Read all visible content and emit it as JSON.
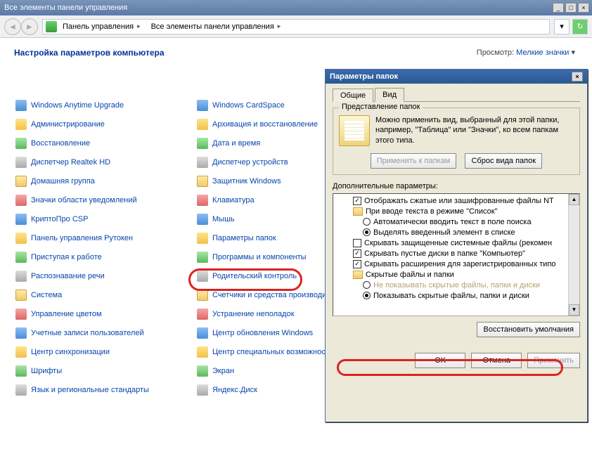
{
  "window": {
    "title": "Все элементы панели управления"
  },
  "breadcrumb": {
    "a": "Панель управления",
    "b": "Все элементы панели управления"
  },
  "page": {
    "heading": "Настройка параметров компьютера",
    "view_label": "Просмотр:",
    "view_value": "Мелкие значки"
  },
  "items_left": [
    "Windows Anytime Upgrade",
    "Администрирование",
    "Восстановление",
    "Диспетчер Realtek HD",
    "Домашняя группа",
    "Значки области уведомлений",
    "КриптоПро CSP",
    "Панель управления Рутокен",
    "Приступая к работе",
    "Распознавание речи",
    "Система",
    "Управление цветом",
    "Учетные записи пользователей",
    "Центр синхронизации",
    "Шрифты",
    "Язык и региональные стандарты"
  ],
  "items_right": [
    "Windows CardSpace",
    "Архивация и восстановление",
    "Дата и время",
    "Диспетчер устройств",
    "Защитник Windows",
    "Клавиатура",
    "Мышь",
    "Параметры папок",
    "Программы и компоненты",
    "Родительский контроль",
    "Счетчики и средства производите",
    "Устранение неполадок",
    "Центр обновления Windows",
    "Центр специальных возможностей",
    "Экран",
    "Яндекс.Диск"
  ],
  "dialog": {
    "title": "Параметры папок",
    "tabs": {
      "general": "Общие",
      "view": "Вид"
    },
    "folder_view": {
      "legend": "Представление папок",
      "text": "Можно применить вид, выбранный для этой папки, например, \"Таблица\" или \"Значки\", ко всем папкам этого типа.",
      "apply_btn": "Применить к папкам",
      "reset_btn": "Сброс вида папок"
    },
    "advanced": {
      "label": "Дополнительные параметры:",
      "rows": [
        {
          "kind": "check",
          "checked": true,
          "indent": 1,
          "text": "Отображать сжатые или зашифрованные файлы NT"
        },
        {
          "kind": "folder",
          "indent": 1,
          "text": "При вводе текста в режиме \"Список\""
        },
        {
          "kind": "radio",
          "checked": false,
          "indent": 2,
          "text": "Автоматически вводить текст в поле поиска"
        },
        {
          "kind": "radio",
          "checked": true,
          "indent": 2,
          "text": "Выделять введенный элемент в списке"
        },
        {
          "kind": "check",
          "checked": false,
          "indent": 1,
          "text": "Скрывать защищенные системные файлы (рекомен"
        },
        {
          "kind": "check",
          "checked": true,
          "indent": 1,
          "text": "Скрывать пустые диски в папке \"Компьютер\""
        },
        {
          "kind": "check",
          "checked": true,
          "indent": 1,
          "text": "Скрывать расширения для зарегистрированных типо"
        },
        {
          "kind": "folder",
          "indent": 1,
          "text": "Скрытые файлы и папки"
        },
        {
          "kind": "radio",
          "checked": false,
          "indent": 2,
          "ghost": true,
          "text": "Не показывать скрытые файлы, папки и диски"
        },
        {
          "kind": "radio",
          "checked": true,
          "indent": 2,
          "text": "Показывать скрытые файлы, папки и диски"
        }
      ],
      "restore_btn": "Восстановить умолчания"
    },
    "footer": {
      "ok": "OK",
      "cancel": "Отмена",
      "apply": "Применить"
    }
  }
}
